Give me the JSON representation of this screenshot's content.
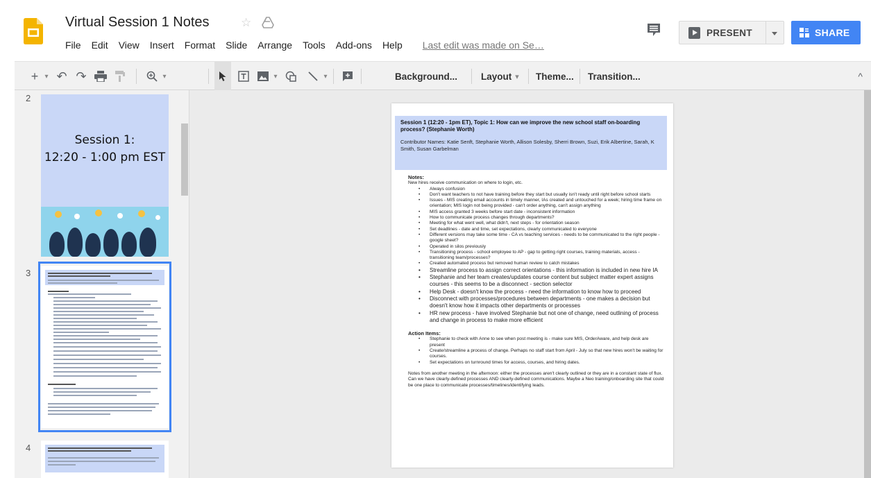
{
  "header": {
    "title": "Virtual Session 1 Notes",
    "menu": [
      "File",
      "Edit",
      "View",
      "Insert",
      "Format",
      "Slide",
      "Arrange",
      "Tools",
      "Add-ons",
      "Help"
    ],
    "last_edit": "Last edit was made on Se…",
    "present_label": "PRESENT",
    "share_label": "SHARE",
    "share_color": "#4285f4"
  },
  "toolbar": {
    "background": "Background...",
    "layout": "Layout",
    "theme": "Theme...",
    "transition": "Transition..."
  },
  "filmstrip": {
    "slides": [
      {
        "number": "2",
        "title_line1": "Session 1:",
        "title_line2": "12:20 - 1:00 pm EST"
      },
      {
        "number": "3"
      },
      {
        "number": "4"
      }
    ],
    "selected_color": "#4285f4"
  },
  "slide": {
    "title": "Session 1 (12:20 - 1pm ET), Topic 1: How can we improve the new school staff on-boarding process? (Stephanie Worth)",
    "contributors": "Contributor Names: Katie Senft, Stephanie Worth, Allison Solesby, Sherri Brown, Suzi, Erik Albertine, Sarah, K Smith, Susan Garbelman",
    "notes_heading": "Notes:",
    "notes_intro": "New hires receive communication on where to login, etc.",
    "notes": [
      "Always confusion",
      "Don't want teachers to not have training before they start but usually isn't ready until right before school starts",
      "Issues - MIS creating email accounts in timely manner, IAs created and untouched for a week; hiring time frame on orientation; MIS login not being provided - can't order anything, can't assign anything",
      "MIS access granted 3 weeks before start date - inconsistent information",
      "How to communicate process changes through departments?",
      "Meeting for what went well, what didn't, next steps - for orientation season",
      "Set deadlines - date and time, set expectations, clearly communicated to everyone",
      "Different versions may take some time - CA vs teaching services - needs to be communicated to the right people - google sheet?",
      "Operated in silos previously",
      "Transitioning process - school employee to AP - gap to getting right courses, training materials, access - transitioning team/processes?",
      "Created automated process but removed human review to catch mistakes"
    ],
    "notes_large": [
      "Streamline process to assign correct orientations - this information is included in new hire IA",
      "Stephanie and her team creates/updates course content but subject matter expert assigns courses - this seems to be a disconnect - section selector",
      "Help Desk - doesn't know the process - need the information to know how to proceed",
      "Disconnect with processes/procedures between departments - one makes a decision but doesn't know how it impacts other departments or processes",
      "HR new process - have involved Stephanie but not one of change, need outlining of process and change in process to make more efficient"
    ],
    "action_heading": "Action Items:",
    "actions": [
      "Stephanie to check with Anne to see when post meeting is - make sure MIS, OrderAware, and help desk are present",
      "Create/streamline a process of change. Perhaps no staff start from April - July so that new hires won't be waiting for courses.",
      "Set expectations on turnround times for access, courses, and hiring dates."
    ],
    "closing": "Notes from another meeting in the afternoon: either the processes aren't clearly outlined or they are in a constant state of flux. Can we have clearly-defined processes AND clearly-defined communications. Maybe a Neo training/onboarding site that could be one place to communicate processes/timelines/identifying leads."
  }
}
